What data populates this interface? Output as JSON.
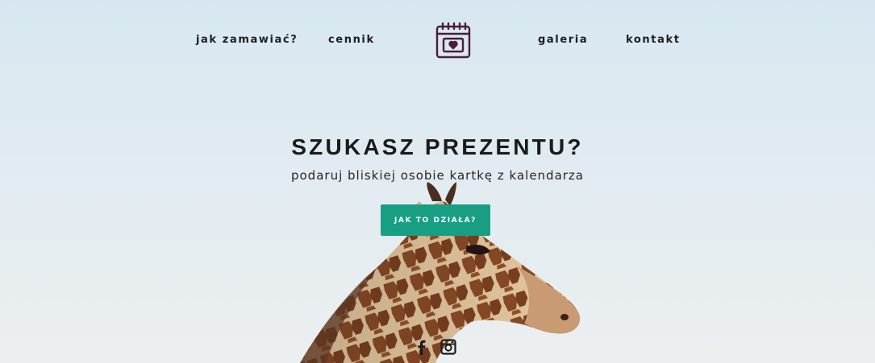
{
  "nav": {
    "items": [
      {
        "label": "jak zamawiać?"
      },
      {
        "label": "cennik"
      },
      {
        "label": "galeria"
      },
      {
        "label": "kontakt"
      }
    ],
    "logo_icon": "calendar-heart-icon"
  },
  "hero": {
    "title": "SZUKASZ PREZENTU?",
    "subtitle": "podaruj bliskiej osobie kartkę z kalendarza",
    "cta_label": "JAK TO DZIAŁA?",
    "background": "giraffe-photo"
  },
  "social": {
    "icons": [
      "facebook-icon",
      "instagram-icon"
    ]
  },
  "colors": {
    "accent": "#179e83",
    "logo": "#4a1e3a",
    "text": "#1f1f1f"
  }
}
